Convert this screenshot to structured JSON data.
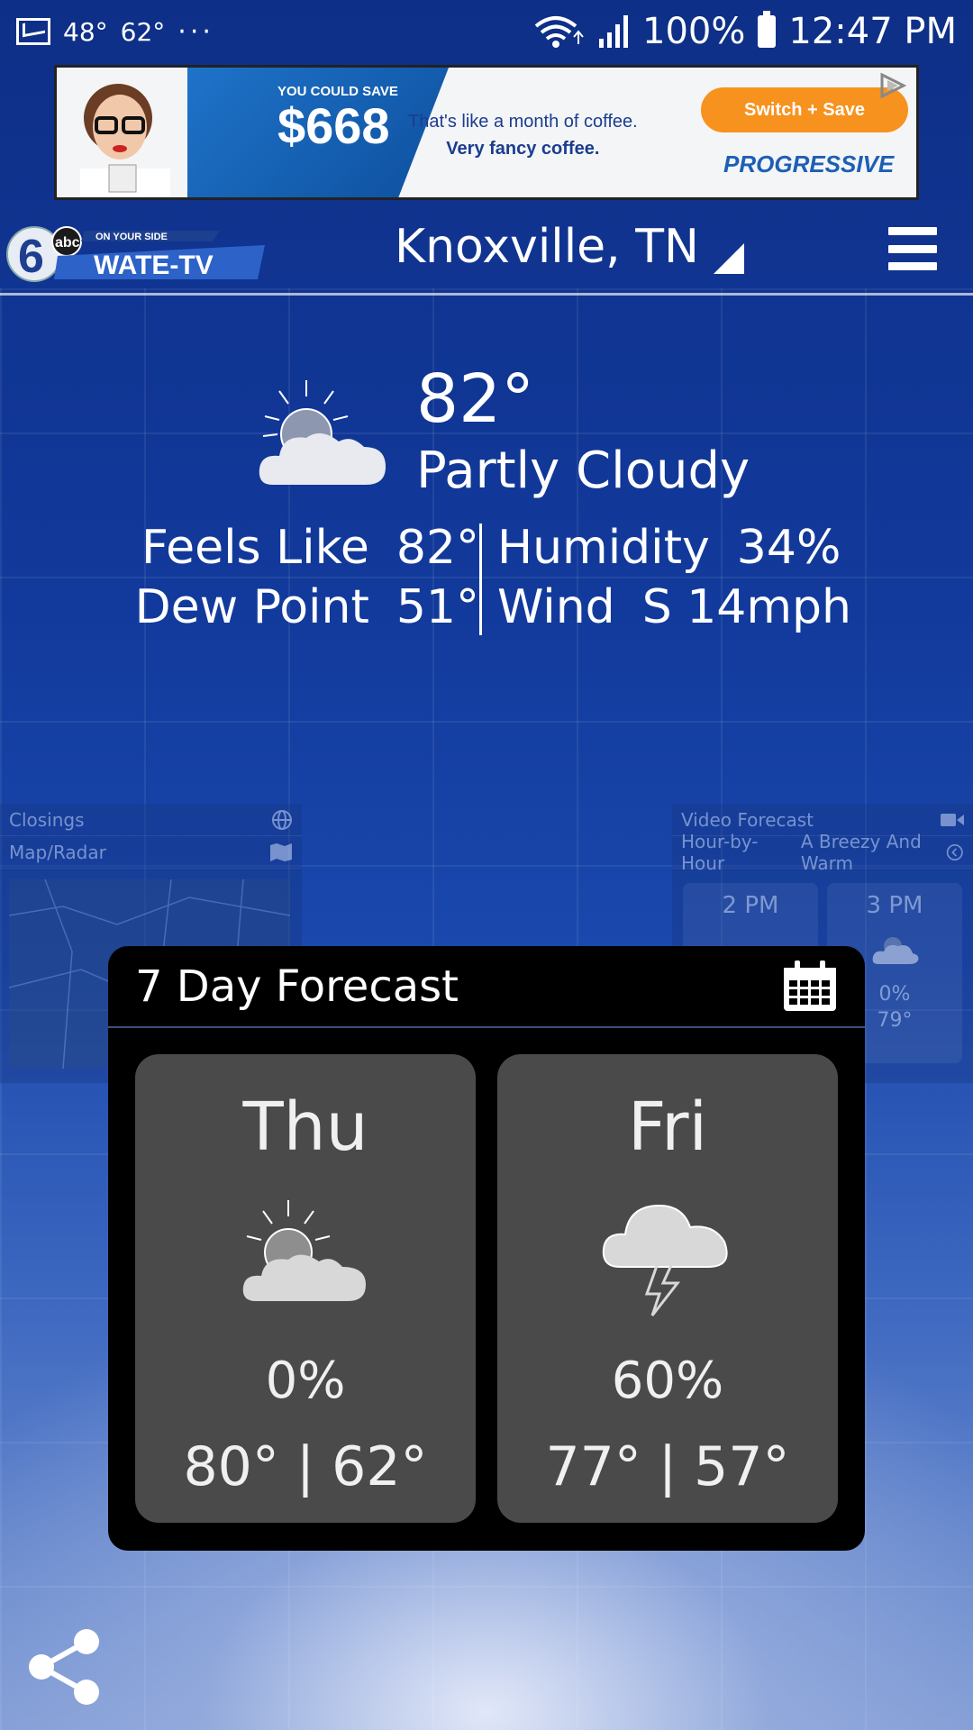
{
  "status_bar": {
    "temp_low": "48°",
    "temp_high": "62°",
    "more": "···",
    "battery": "100%",
    "time": "12:47 PM"
  },
  "ad": {
    "headline_small": "YOU COULD SAVE",
    "amount": "$668",
    "copy_line1": "That's like a month of coffee.",
    "copy_line2": "Very fancy coffee.",
    "cta": "Switch + Save",
    "brand": "PROGRESSIVE"
  },
  "header": {
    "location": "Knoxville, TN"
  },
  "current": {
    "temperature": "82°",
    "condition": "Partly Cloudy",
    "feels_like_label": "Feels Like",
    "feels_like_value": "82°",
    "dew_point_label": "Dew Point",
    "dew_point_value": "51°",
    "humidity_label": "Humidity",
    "humidity_value": "34%",
    "wind_label": "Wind",
    "wind_value": "S 14mph"
  },
  "background_cards": {
    "closings": "Closings",
    "map_radar": "Map/Radar",
    "video_forecast": "Video Forecast",
    "hour_by_hour": "Hour-by-Hour",
    "video_title": "A Breezy And Warm",
    "hours": [
      {
        "time": "2 PM"
      },
      {
        "time": "3 PM",
        "precip": "0%",
        "temp": "79°"
      }
    ]
  },
  "forecast": {
    "title": "7 Day Forecast",
    "days": [
      {
        "day": "Thu",
        "icon": "partly-cloudy-icon",
        "precip": "0%",
        "hilo": "80° | 62°"
      },
      {
        "day": "Fri",
        "icon": "thunderstorm-icon",
        "precip": "60%",
        "hilo": "77° | 57°"
      }
    ]
  },
  "colors": {
    "background": "#0d2f8a",
    "card": "#000000",
    "day_tile": "#4a4a4a",
    "ad_cta": "#f7921e"
  }
}
